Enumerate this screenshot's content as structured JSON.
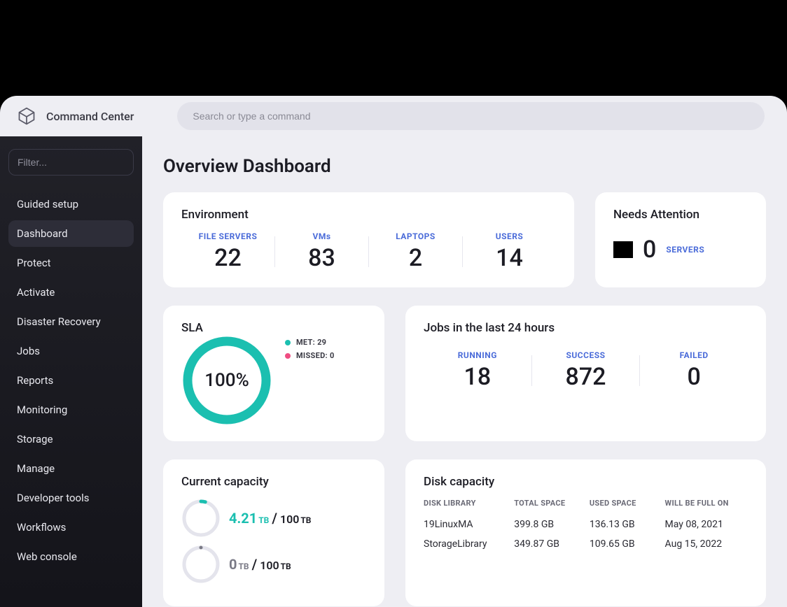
{
  "brand": "Command Center",
  "search": {
    "placeholder": "Search or type a command"
  },
  "sidebar": {
    "filter_placeholder": "Filter...",
    "items": [
      {
        "label": "Guided setup",
        "active": false
      },
      {
        "label": "Dashboard",
        "active": true
      },
      {
        "label": "Protect",
        "active": false
      },
      {
        "label": "Activate",
        "active": false
      },
      {
        "label": "Disaster Recovery",
        "active": false
      },
      {
        "label": "Jobs",
        "active": false
      },
      {
        "label": "Reports",
        "active": false
      },
      {
        "label": "Monitoring",
        "active": false
      },
      {
        "label": "Storage",
        "active": false
      },
      {
        "label": "Manage",
        "active": false
      },
      {
        "label": "Developer tools",
        "active": false
      },
      {
        "label": "Workflows",
        "active": false
      },
      {
        "label": "Web console",
        "active": false
      }
    ]
  },
  "page": {
    "title": "Overview Dashboard"
  },
  "environment": {
    "title": "Environment",
    "stats": [
      {
        "label": "FILE SERVERS",
        "value": "22"
      },
      {
        "label": "VMs",
        "value": "83"
      },
      {
        "label": "LAPTOPS",
        "value": "2"
      },
      {
        "label": "USERS",
        "value": "14"
      }
    ]
  },
  "needs": {
    "title": "Needs Attention",
    "value": "0",
    "label": "SERVERS"
  },
  "sla": {
    "title": "SLA",
    "percent": "100%",
    "legend_met": "MET: 29",
    "legend_missed": "MISSED: 0"
  },
  "jobs": {
    "title": "Jobs in the last 24 hours",
    "stats": [
      {
        "label": "RUNNING",
        "value": "18"
      },
      {
        "label": "SUCCESS",
        "value": "872"
      },
      {
        "label": "FAILED",
        "value": "0"
      }
    ]
  },
  "capacity": {
    "title": "Current capacity",
    "rows": [
      {
        "used": "4.21",
        "used_unit": "TB",
        "total": "100",
        "total_unit": "TB",
        "frac": 0.042,
        "color": "#1bbfb0"
      },
      {
        "used": "0",
        "used_unit": "TB",
        "total": "100",
        "total_unit": "TB",
        "frac": 0,
        "color": "#7a7a86"
      }
    ]
  },
  "disk": {
    "title": "Disk capacity",
    "columns": [
      "DISK LIBRARY",
      "TOTAL SPACE",
      "USED SPACE",
      "WILL BE FULL ON"
    ],
    "rows": [
      {
        "lib": "19LinuxMA",
        "total": "399.8 GB",
        "used": "136.13 GB",
        "full": "May 08, 2021"
      },
      {
        "lib": "StorageLibrary",
        "total": "349.87 GB",
        "used": "109.65 GB",
        "full": "Aug 15, 2022"
      }
    ]
  },
  "chart_data": [
    {
      "type": "pie",
      "title": "SLA",
      "series": [
        {
          "name": "MET",
          "value": 29,
          "color": "#1bbfb0"
        },
        {
          "name": "MISSED",
          "value": 0,
          "color": "#ef4d82"
        }
      ],
      "center_label": "100%"
    }
  ]
}
